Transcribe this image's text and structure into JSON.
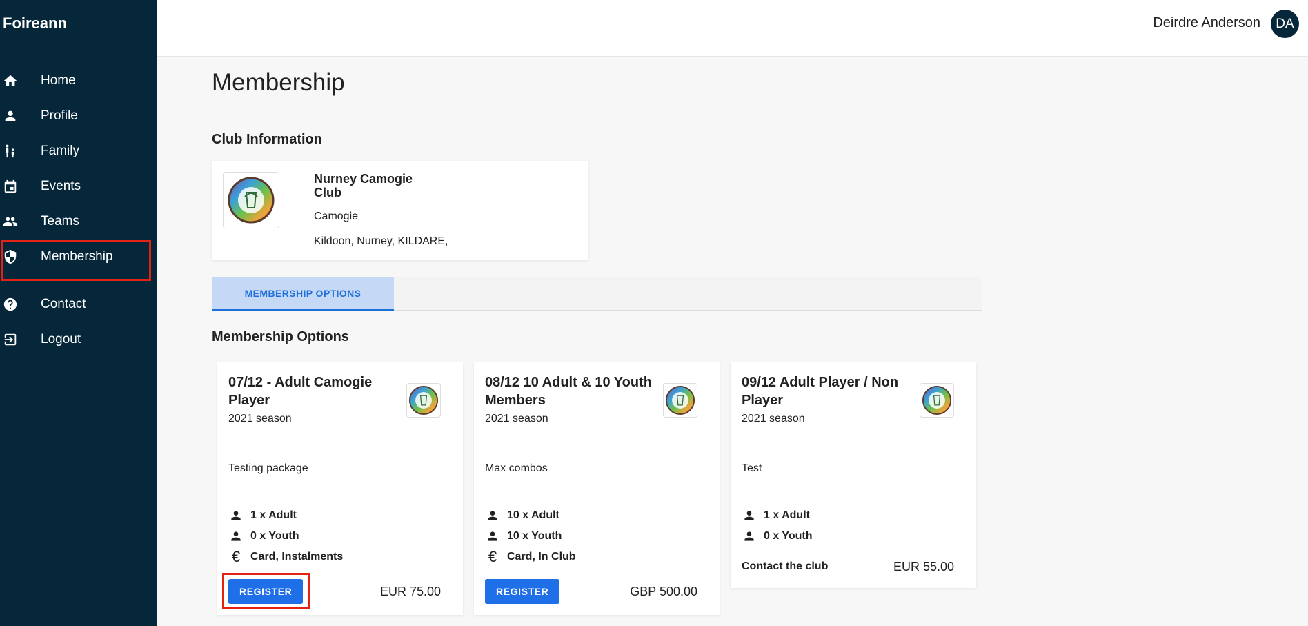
{
  "app": {
    "brand": "Foireann"
  },
  "sidebar": {
    "items": [
      {
        "label": "Home",
        "icon": "home-icon"
      },
      {
        "label": "Profile",
        "icon": "person-icon"
      },
      {
        "label": "Family",
        "icon": "family-icon"
      },
      {
        "label": "Events",
        "icon": "calendar-icon"
      },
      {
        "label": "Teams",
        "icon": "group-icon"
      },
      {
        "label": "Membership",
        "icon": "shield-icon",
        "active": true
      },
      {
        "label": "Contact",
        "icon": "help-icon"
      },
      {
        "label": "Logout",
        "icon": "logout-icon"
      }
    ]
  },
  "header": {
    "user_name": "Deirdre Anderson",
    "avatar_initials": "DA"
  },
  "main": {
    "page_title": "Membership",
    "club_section_title": "Club Information",
    "club": {
      "name": "Nurney Camogie Club",
      "sport": "Camogie",
      "address": "Kildoon, Nurney, KILDARE,"
    },
    "tabs": [
      {
        "label": "MEMBERSHIP OPTIONS",
        "active": true
      }
    ],
    "options_section_title": "Membership Options",
    "options": [
      {
        "title": "07/12 - Adult Camogie Player",
        "season": "2021 season",
        "description": "Testing package",
        "adult": "1 x Adult",
        "youth": "0 x Youth",
        "payment": "Card, Instalments",
        "action_label": "REGISTER",
        "price": "EUR 75.00"
      },
      {
        "title": "08/12 10 Adult & 10 Youth Members",
        "season": "2021 season",
        "description": "Max combos",
        "adult": "10 x Adult",
        "youth": "10 x Youth",
        "payment": "Card, In Club",
        "action_label": "REGISTER",
        "price": "GBP 500.00"
      },
      {
        "title": "09/12 Adult Player / Non Player",
        "season": "2021 season",
        "description": "Test",
        "adult": "1 x Adult",
        "youth": "0 x Youth",
        "contact_text": "Contact the club",
        "price": "EUR 55.00"
      }
    ]
  },
  "colors": {
    "sidebar_bg": "#06263a",
    "accent": "#1e6fe8",
    "tab_bg": "#c5d8f6",
    "highlight": "#e32214"
  }
}
